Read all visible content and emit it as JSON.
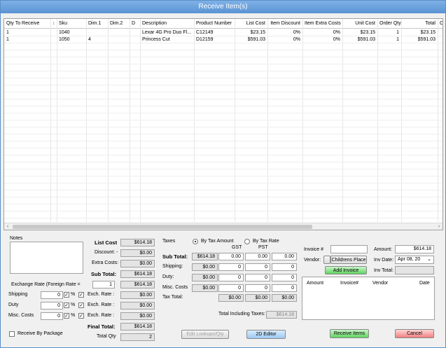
{
  "window": {
    "title": "Receive Item(s)"
  },
  "grid": {
    "columns": [
      "Qty To Receive",
      "",
      "Sku",
      "Dim.1",
      "Dim.2",
      "D",
      "Description",
      "Product Number",
      "List Cost",
      "Item Discount",
      "Item Extra Costs",
      "Unit Cost",
      "Order Qty",
      "Total",
      "Cu"
    ],
    "rows": [
      [
        "1",
        "",
        "1040",
        "",
        "",
        "",
        "Lexar 4G Pro Duo Fl...",
        "C12149",
        "$23.15",
        "0%",
        "0%",
        "$23.15",
        "1",
        "$23.15"
      ],
      [
        "1",
        "",
        "1050",
        "4",
        "",
        "",
        "Princess Cut",
        "D12159",
        "$591.03",
        "0%",
        "0%",
        "$591.03",
        "1",
        "$591.03"
      ]
    ]
  },
  "notes": {
    "label": "Notes",
    "value": ""
  },
  "costs": {
    "list_cost_label": "List Cost",
    "list_cost": "$614.18",
    "discount_label": "Discount: -",
    "discount": "$0.00",
    "extra_costs_label": "Extra Costs: +",
    "extra_costs": "$0.00",
    "sub_total_label": "Sub Total:",
    "sub_total": "$614.18",
    "exch_rate_value": "1",
    "exch_subtotal": "$614.18",
    "final_total_label": "Final Total:",
    "final_total": "$614.18",
    "total_qty_label": "Total Qty",
    "total_qty": "2"
  },
  "exchange": {
    "label": "Exchange Rate  (Foreign  Rate =",
    "shipping_label": "Shipping",
    "shipping": "0",
    "duty_label": "Duty",
    "duty": "0",
    "misc_label": "Misc. Costs",
    "misc": "0",
    "pct": "%",
    "exch_rate_label": "Exch. Rate :",
    "shipping_rate": "$0.00",
    "duty_rate": "$0.00",
    "misc_rate": "$0.00"
  },
  "receive_by_package": "Receive By Package",
  "taxes": {
    "label": "Taxes",
    "by_amount": "By Tax Amount",
    "by_rate": "By Tax Rate",
    "gst": "GST",
    "pst": "PST",
    "sub_total_label": "Sub Total:",
    "sub_total": "$614.18",
    "sub_gst": "0.00",
    "sub_pst": "0.00",
    "sub_other": "0.00",
    "shipping_label": "Shipping:",
    "shipping": "$0.00",
    "ship_gst": "0",
    "ship_pst": "0",
    "ship_other": "0",
    "duty_label": "Duty:",
    "duty": "$0.00",
    "duty_gst": "0",
    "duty_pst": "0",
    "duty_other": "0",
    "misc_label": "Misc. Costs",
    "misc": "$0.00",
    "misc_gst": "0",
    "misc_pst": "0",
    "misc_other": "0",
    "tax_total_label": "Tax Total:",
    "tt1": "$0.00",
    "tt2": "$0.00",
    "tt3": "$0.00",
    "total_incl_label": "Total Including Taxes:",
    "total_incl": "$614.18"
  },
  "invoice": {
    "invoice_label": "Invoice #",
    "invoice": "",
    "amount_label": "Amount:",
    "amount": "$614.18",
    "vendor_label": "Vendor:",
    "vendor": "Childrens Place",
    "inv_date_label": "Inv Date:",
    "inv_date": "Apr 08, 20",
    "add_invoice": "Add Invoice",
    "inv_total_label": "Inv Total:",
    "inv_total": "",
    "table_headers": [
      "Amount",
      "Invoice#",
      "Vendor",
      "Date"
    ]
  },
  "buttons": {
    "edit_lookups": "Edit Lookups/Qty",
    "editor_2d": "2D Editor",
    "receive_items": "Receive Items",
    "cancel": "Cancel"
  }
}
